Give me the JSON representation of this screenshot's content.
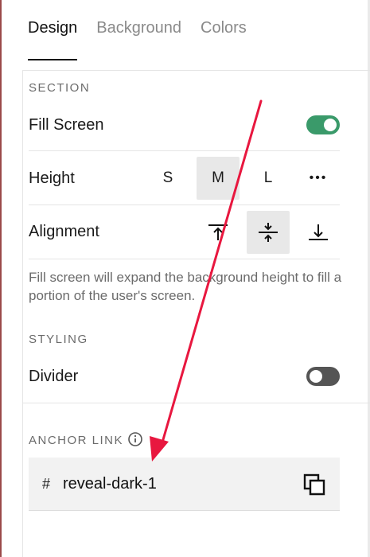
{
  "tabs": [
    {
      "label": "Design",
      "active": true
    },
    {
      "label": "Background",
      "active": false
    },
    {
      "label": "Colors",
      "active": false
    }
  ],
  "section": {
    "heading": "SECTION",
    "fill_screen": {
      "label": "Fill Screen",
      "enabled": true
    },
    "height": {
      "label": "Height",
      "options": [
        "S",
        "M",
        "L",
        "•••"
      ],
      "selected": "M"
    },
    "alignment": {
      "label": "Alignment",
      "options": [
        "align-top-icon",
        "align-middle-icon",
        "align-bottom-icon"
      ],
      "selected": "align-middle-icon"
    },
    "help_text": "Fill screen will expand the background height to fill a portion of the user's screen."
  },
  "styling": {
    "heading": "STYLING",
    "divider": {
      "label": "Divider",
      "enabled": false
    }
  },
  "anchor_link": {
    "heading": "ANCHOR LINK",
    "prefix": "#",
    "value": "reveal-dark-1"
  },
  "colors": {
    "toggle_on": "#3a9a6a",
    "toggle_off": "#555555",
    "annotation_arrow": "#e8173f"
  }
}
